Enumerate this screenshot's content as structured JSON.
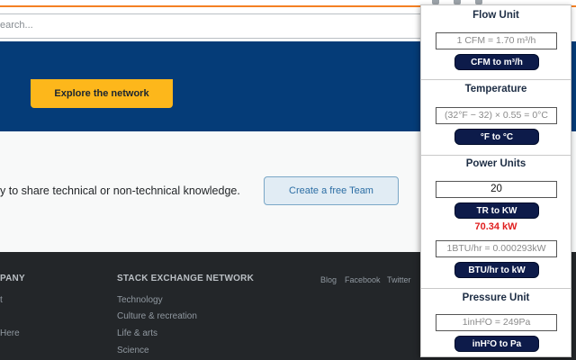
{
  "website": {
    "search": {
      "placeholder": "earch..."
    },
    "hero": {
      "cta_label": "Explore the network"
    },
    "middle": {
      "text": "y to share technical or non-technical knowledge.",
      "cta_label": "Create a free Team"
    },
    "footer": {
      "company_heading": "PANY",
      "company_links": [
        "t",
        "Here"
      ],
      "network_heading": "STACK EXCHANGE NETWORK",
      "network_links": [
        "Technology",
        "Culture & recreation",
        "Life & arts",
        "Science"
      ],
      "social_links": [
        "Blog",
        "Facebook",
        "Twitter"
      ]
    }
  },
  "popup": {
    "flow": {
      "title": "Flow Unit",
      "formula": "1 CFM = 1.70 m³/h",
      "button_label": "CFM to m³/h"
    },
    "temperature": {
      "title": "Temperature",
      "formula": "(32°F − 32) × 0.55 = 0°C",
      "button_label": "°F to °C"
    },
    "power": {
      "title": "Power Units",
      "input_value": "20",
      "tr_button_label": "TR to KW",
      "result": "70.34 kW",
      "btu_formula": "1BTU/hr = 0.000293kW",
      "btu_button_label": "BTU/hr to kW"
    },
    "pressure": {
      "title": "Pressure Unit",
      "formula": "1inH²O = 249Pa",
      "button_label": "inH²O to Pa"
    }
  },
  "colors": {
    "hero_blue": "#053c78",
    "cta_orange": "#fdb71b",
    "button_navy": "#0d1b4a",
    "result_red": "#e02020",
    "footer_dark": "#232629"
  }
}
